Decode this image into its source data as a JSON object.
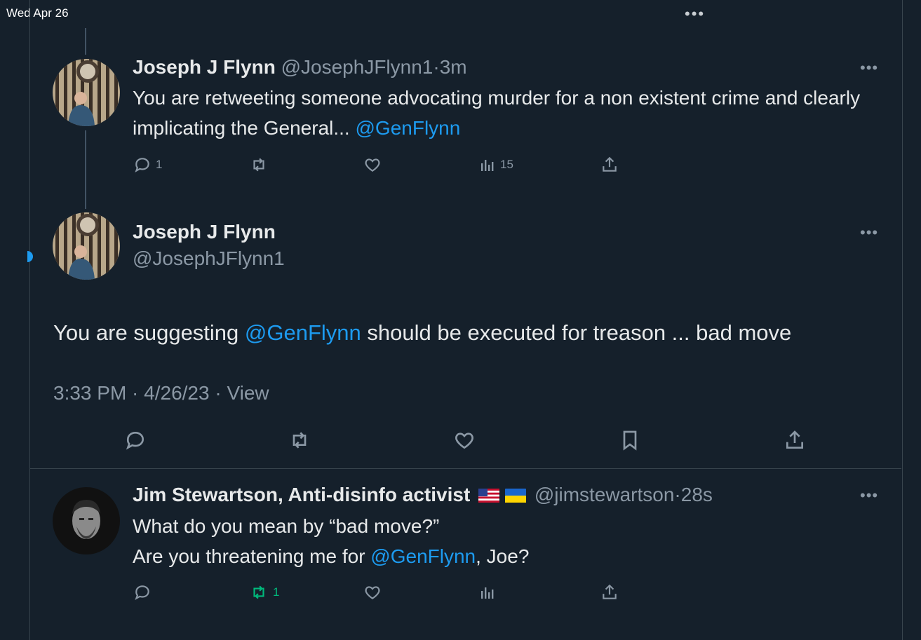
{
  "status_bar": {
    "date": "Wed Apr 26",
    "more_icon": "ellipsis-icon"
  },
  "reply_tweet": {
    "display_name": "Joseph J Flynn",
    "handle": "@JosephJFlynn1",
    "separator": "·",
    "time": "3m",
    "text_before": "You are retweeting someone advocating murder for a non existent crime and clearly implicating the General... ",
    "mention": "@GenFlynn",
    "actions": {
      "reply_count": "1",
      "retweet_count": "",
      "like_count": "",
      "views_count": "15"
    }
  },
  "main_tweet": {
    "display_name": "Joseph J Flynn",
    "handle": "@JosephJFlynn1",
    "text_before": "You are suggesting ",
    "mention": "@GenFlynn",
    "text_after": " should be executed for treason ... bad move",
    "timestamp": "3:33 PM · 4/26/23 · ",
    "view_link": "View"
  },
  "bottom_tweet": {
    "display_name": "Jim Stewartson, Anti-disinfo activist",
    "flags": [
      "us-flag",
      "ukraine-flag"
    ],
    "handle": "@jimstewartson",
    "separator": "·",
    "time": "28s",
    "line1": "What do you mean by “bad move?”",
    "line2_before": "Are you threatening me for ",
    "mention": "@GenFlynn",
    "line2_after": ", Joe?",
    "actions": {
      "retweet_count": "1",
      "retweet_color": "#00ba7c"
    }
  },
  "colors": {
    "background": "#15202b",
    "link": "#1d9bf0",
    "muted": "#8b98a5",
    "divider": "#38444d"
  }
}
